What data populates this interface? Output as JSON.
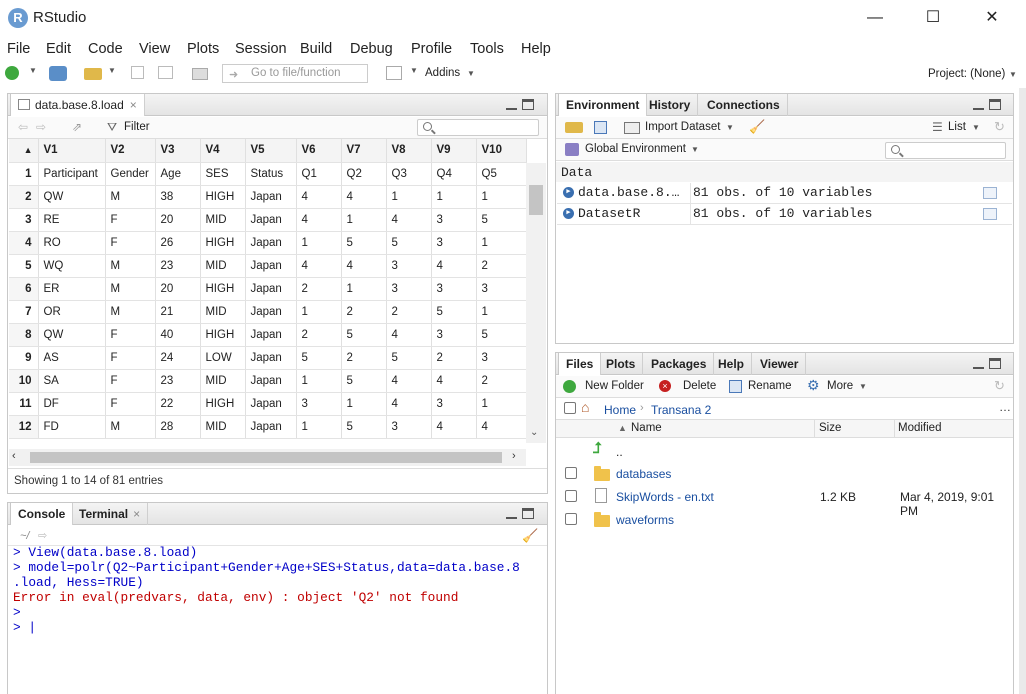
{
  "window": {
    "title": "RStudio",
    "minimize": "—",
    "maximize": "☐",
    "close": "✕"
  },
  "menu": [
    "File",
    "Edit",
    "Code",
    "View",
    "Plots",
    "Session",
    "Build",
    "Debug",
    "Profile",
    "Tools",
    "Help"
  ],
  "toolbar": {
    "goto_placeholder": "Go to file/function",
    "addins": "Addins",
    "project": "Project: (None)"
  },
  "data_viewer": {
    "tab_label": "data.base.8.load",
    "filter_label": "Filter",
    "columns": [
      "V1",
      "V2",
      "V3",
      "V4",
      "V5",
      "V6",
      "V7",
      "V8",
      "V9",
      "V10"
    ],
    "rows": [
      [
        "1",
        "Participant",
        "Gender",
        "Age",
        "SES",
        "Status",
        "Q1",
        "Q2",
        "Q3",
        "Q4",
        "Q5"
      ],
      [
        "2",
        "QW",
        "M",
        "38",
        "HIGH",
        "Japan",
        "4",
        "4",
        "1",
        "1",
        "1"
      ],
      [
        "3",
        "RE",
        "F",
        "20",
        "MID",
        "Japan",
        "4",
        "1",
        "4",
        "3",
        "5"
      ],
      [
        "4",
        "RO",
        "F",
        "26",
        "HIGH",
        "Japan",
        "1",
        "5",
        "5",
        "3",
        "1"
      ],
      [
        "5",
        "WQ",
        "M",
        "23",
        "MID",
        "Japan",
        "4",
        "4",
        "3",
        "4",
        "2"
      ],
      [
        "6",
        "ER",
        "M",
        "20",
        "HIGH",
        "Japan",
        "2",
        "1",
        "3",
        "3",
        "3"
      ],
      [
        "7",
        "OR",
        "M",
        "21",
        "MID",
        "Japan",
        "1",
        "2",
        "2",
        "5",
        "1"
      ],
      [
        "8",
        "QW",
        "F",
        "40",
        "HIGH",
        "Japan",
        "2",
        "5",
        "4",
        "3",
        "5"
      ],
      [
        "9",
        "AS",
        "F",
        "24",
        "LOW",
        "Japan",
        "5",
        "2",
        "5",
        "2",
        "3"
      ],
      [
        "10",
        "SA",
        "F",
        "23",
        "MID",
        "Japan",
        "1",
        "5",
        "4",
        "4",
        "2"
      ],
      [
        "11",
        "DF",
        "F",
        "22",
        "HIGH",
        "Japan",
        "3",
        "1",
        "4",
        "3",
        "1"
      ],
      [
        "12",
        "FD",
        "M",
        "28",
        "MID",
        "Japan",
        "1",
        "5",
        "3",
        "4",
        "4"
      ]
    ],
    "status": "Showing 1 to 14 of 81 entries"
  },
  "console": {
    "tabs": [
      "Console",
      "Terminal"
    ],
    "path": "~/",
    "lines": [
      {
        "text": "> View(data.base.8.load)",
        "kind": "input"
      },
      {
        "text": "> model=polr(Q2~Participant+Gender+Age+SES+Status,data=data.base.8",
        "kind": "input"
      },
      {
        "text": ".load, Hess=TRUE)",
        "kind": "input"
      },
      {
        "text": "Error in eval(predvars, data, env) : object 'Q2' not found",
        "kind": "error"
      },
      {
        "text": ">",
        "kind": "input"
      },
      {
        "text": "> |",
        "kind": "input"
      }
    ]
  },
  "environment": {
    "tabs": [
      "Environment",
      "History",
      "Connections"
    ],
    "import_label": "Import Dataset",
    "list_label": "List",
    "scope_label": "Global Environment",
    "section": "Data",
    "rows": [
      {
        "name": "data.base.8.…",
        "value": "81 obs. of 10 variables"
      },
      {
        "name": "DatasetR",
        "value": "81 obs. of 10 variables"
      }
    ]
  },
  "files": {
    "tabs": [
      "Files",
      "Plots",
      "Packages",
      "Help",
      "Viewer"
    ],
    "actions": {
      "new_folder": "New Folder",
      "delete": "Delete",
      "rename": "Rename",
      "more": "More"
    },
    "breadcrumb": [
      "Home",
      "Transana 2"
    ],
    "headers": {
      "name": "Name",
      "size": "Size",
      "modified": "Modified"
    },
    "up_label": "..",
    "items": [
      {
        "name": "databases",
        "size": "",
        "modified": "",
        "type": "folder"
      },
      {
        "name": "SkipWords - en.txt",
        "size": "1.2 KB",
        "modified": "Mar 4, 2019, 9:01 PM",
        "type": "file"
      },
      {
        "name": "waveforms",
        "size": "",
        "modified": "",
        "type": "folder"
      }
    ]
  },
  "colors": {
    "accent": "#1a4fa0",
    "error": "#c00000",
    "console_input": "#0000c8"
  }
}
